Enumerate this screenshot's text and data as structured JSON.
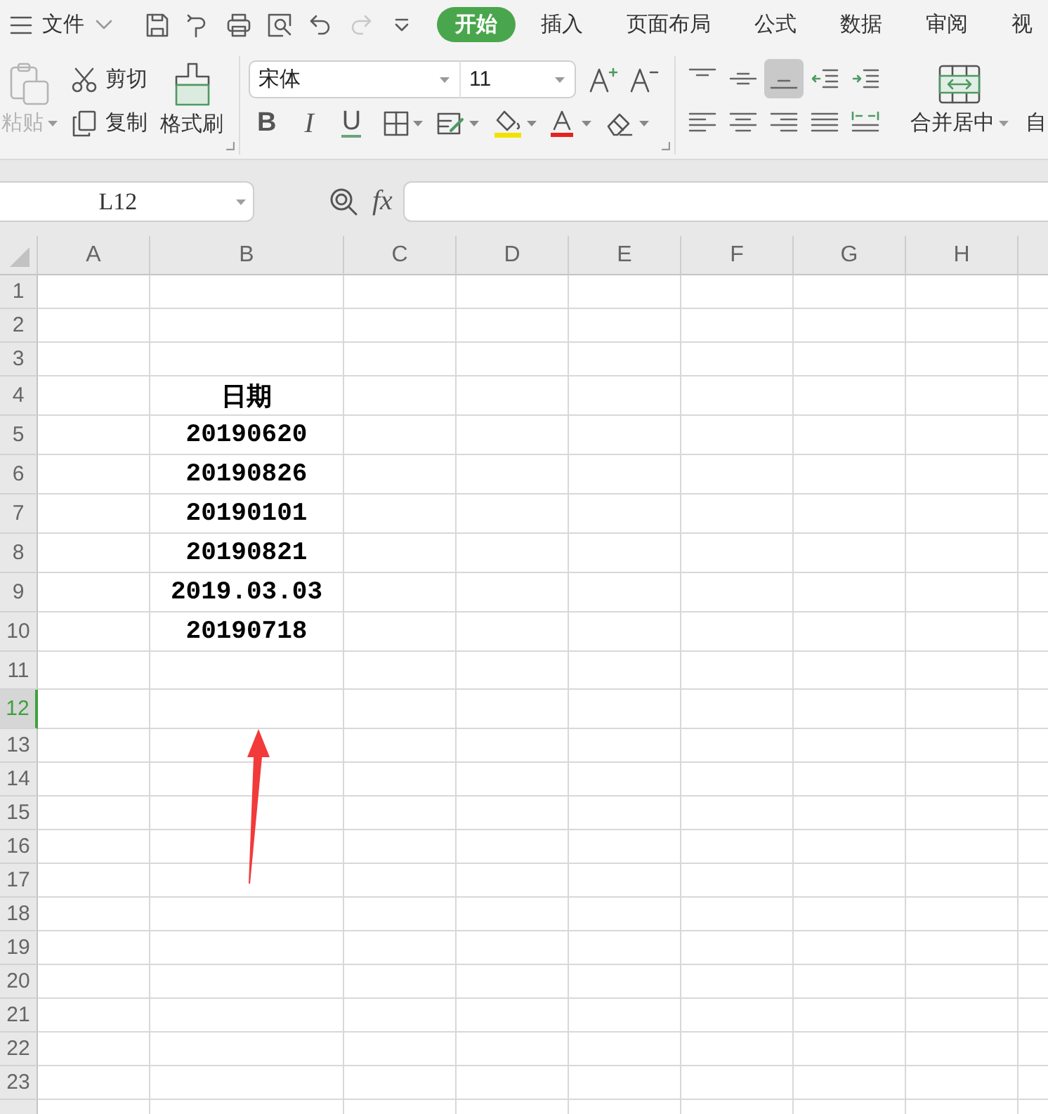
{
  "quick_access": {
    "menu_label": "文件",
    "tools": [
      {
        "kind": "save",
        "disabled": false
      },
      {
        "kind": "share",
        "disabled": false
      },
      {
        "kind": "print",
        "disabled": false
      },
      {
        "kind": "preview",
        "disabled": false
      },
      {
        "kind": "undo",
        "disabled": false
      },
      {
        "kind": "redo",
        "disabled": true
      },
      {
        "kind": "customize",
        "disabled": false
      }
    ]
  },
  "tabs": [
    {
      "label": "开始",
      "selected": true
    },
    {
      "label": "插入",
      "selected": false
    },
    {
      "label": "页面布局",
      "selected": false
    },
    {
      "label": "公式",
      "selected": false
    },
    {
      "label": "数据",
      "selected": false
    },
    {
      "label": "审阅",
      "selected": false
    },
    {
      "label": "视",
      "selected": false
    }
  ],
  "ribbon": {
    "clipboard": {
      "paste": {
        "label": "粘贴",
        "disabled": true
      },
      "cut": "剪切",
      "copy": "复制",
      "format_painter": "格式刷"
    },
    "font": {
      "name": "宋体",
      "size": "11",
      "style_buttons": [
        {
          "kind": "bold",
          "label": "B"
        },
        {
          "kind": "italic",
          "label": "I"
        },
        {
          "kind": "underline",
          "label": "U"
        }
      ]
    },
    "alignment": [
      {
        "kind": "top",
        "selected": false
      },
      {
        "kind": "middle",
        "selected": false
      },
      {
        "kind": "bottom",
        "selected": true
      },
      {
        "kind": "outdent",
        "selected": false
      },
      {
        "kind": "indent",
        "selected": false
      },
      {
        "kind": "left",
        "selected": false
      },
      {
        "kind": "center",
        "selected": false
      },
      {
        "kind": "right",
        "selected": false
      },
      {
        "kind": "justify",
        "selected": false
      },
      {
        "kind": "distributed",
        "selected": false
      }
    ],
    "merge": {
      "label": "合并居中"
    },
    "partial_button": {
      "label": "自"
    }
  },
  "formula_bar": {
    "name_box": "L12",
    "function_label": "fx"
  },
  "sheet": {
    "columns": [
      "A",
      "B",
      "C",
      "D",
      "E",
      "F",
      "G",
      "H"
    ],
    "rows": [
      {
        "number": "1",
        "selected": false
      },
      {
        "number": "2",
        "selected": false
      },
      {
        "number": "3",
        "selected": false
      },
      {
        "number": "4",
        "selected": false,
        "cells": {
          "B": "日期"
        }
      },
      {
        "number": "5",
        "selected": false,
        "cells": {
          "B": "20190620"
        }
      },
      {
        "number": "6",
        "selected": false,
        "cells": {
          "B": "20190826"
        }
      },
      {
        "number": "7",
        "selected": false,
        "cells": {
          "B": "20190101"
        }
      },
      {
        "number": "8",
        "selected": false,
        "cells": {
          "B": "20190821"
        }
      },
      {
        "number": "9",
        "selected": false,
        "cells": {
          "B": "2019.03.03"
        }
      },
      {
        "number": "10",
        "selected": false,
        "cells": {
          "B": "20190718"
        }
      },
      {
        "number": "11",
        "selected": false
      },
      {
        "number": "12",
        "selected": true
      },
      {
        "number": "13",
        "selected": false
      },
      {
        "number": "14",
        "selected": false
      },
      {
        "number": "15",
        "selected": false
      },
      {
        "number": "16",
        "selected": false
      },
      {
        "number": "17",
        "selected": false
      },
      {
        "number": "18",
        "selected": false
      },
      {
        "number": "19",
        "selected": false
      },
      {
        "number": "20",
        "selected": false
      },
      {
        "number": "21",
        "selected": false
      },
      {
        "number": "22",
        "selected": false
      },
      {
        "number": "23",
        "selected": false
      }
    ]
  }
}
